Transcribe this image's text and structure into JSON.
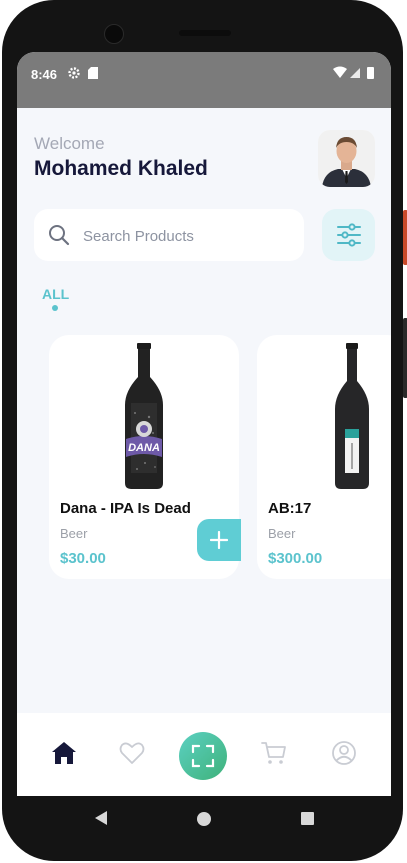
{
  "status_bar": {
    "time": "8:46"
  },
  "header": {
    "greeting": "Welcome",
    "user_name": "Mohamed Khaled"
  },
  "search": {
    "placeholder": "Search Products"
  },
  "categories": [
    {
      "label": "ALL",
      "selected": true
    }
  ],
  "products": [
    {
      "name": "Dana - IPA Is Dead",
      "category": "Beer",
      "price": "$30.00",
      "bottle_label": "DANA"
    },
    {
      "name": "AB:17",
      "category": "Beer",
      "price": "$300.00"
    }
  ],
  "colors": {
    "accent": "#5bc3cd",
    "title": "#16183a",
    "scan_gradient": [
      "#5bd0c2",
      "#3fb27a"
    ]
  },
  "bottom_nav": {
    "items": [
      "home-icon",
      "heart-icon",
      "scan-icon",
      "cart-icon",
      "profile-icon"
    ],
    "active": "home-icon"
  }
}
